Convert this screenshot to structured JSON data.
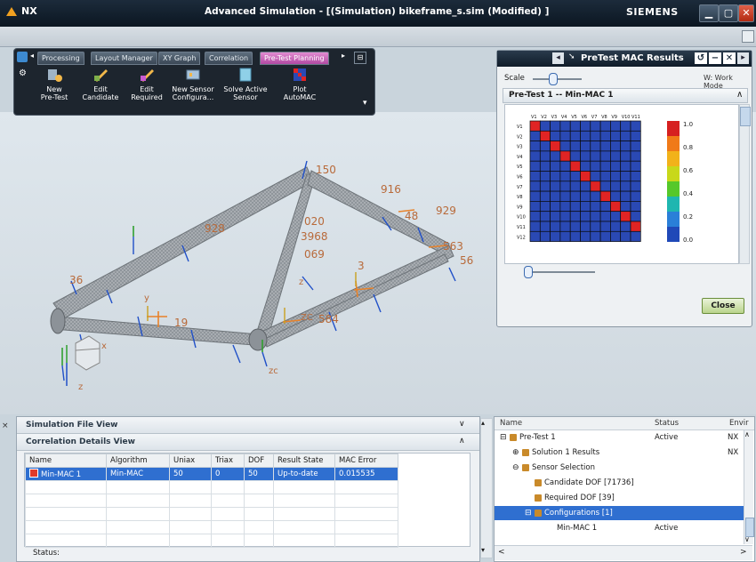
{
  "window": {
    "app": "NX",
    "title": "Advanced Simulation - [(Simulation) bikeframe_s.sim (Modified) ]",
    "brand": "SIEMENS"
  },
  "ribbon": {
    "tabs": [
      "Processing",
      "Layout Manager",
      "XY Graph",
      "Correlation",
      "Pre-Test Planning"
    ],
    "active_tab": "Pre-Test Planning",
    "tools": [
      {
        "line1": "New",
        "line2": "Pre-Test",
        "icon": "new-pretest-icon"
      },
      {
        "line1": "Edit",
        "line2": "Candidate",
        "icon": "edit-candidate-icon"
      },
      {
        "line1": "Edit",
        "line2": "Required",
        "icon": "edit-required-icon"
      },
      {
        "line1": "New Sensor",
        "line2": "Configura...",
        "icon": "new-sensor-configuration-icon"
      },
      {
        "line1": "Solve Active",
        "line2": "Sensor",
        "icon": "solve-active-sensor-icon"
      },
      {
        "line1": "Plot",
        "line2": "AutoMAC",
        "icon": "plot-automac-icon"
      }
    ]
  },
  "mac_dialog": {
    "title": "PreTest MAC Results",
    "scale_label": "Scale",
    "work_mode": "W: Work Mode",
    "selection": "Pre-Test 1 -- Min-MAC 1",
    "col_labels": [
      "V1",
      "V2",
      "V3",
      "V4",
      "V5",
      "V6",
      "V7",
      "V8",
      "V9",
      "V10",
      "V11"
    ],
    "row_labels": [
      "V1",
      "V2",
      "V3",
      "V4",
      "V5",
      "V6",
      "V7",
      "V8",
      "V9",
      "V10",
      "V11",
      "V12"
    ],
    "legend_ticks": [
      "1.0",
      "0.8",
      "0.6",
      "0.4",
      "0.2",
      "0.0"
    ],
    "legend_colors": [
      "#d62020",
      "#f07a18",
      "#f2b21a",
      "#c8d81a",
      "#56c82a",
      "#1fb6b0",
      "#2a7fd8",
      "#2049b8"
    ],
    "diag_color": "#e02424",
    "off_color": "#2a49b4",
    "close_label": "Close"
  },
  "model_labels": [
    "150",
    "916",
    "929",
    "020",
    "3968",
    "48",
    "928",
    "069",
    "563",
    "56",
    "3",
    "584",
    "36",
    "556",
    "z",
    "y",
    "x",
    "z",
    "zc",
    "ZC",
    "19"
  ],
  "sim_file_view": {
    "title": "Simulation File View"
  },
  "correlation_view": {
    "title": "Correlation Details View",
    "columns": [
      "Name",
      "Algorithm",
      "Uniax",
      "Triax",
      "DOF",
      "Result State",
      "MAC Error"
    ],
    "rows": [
      [
        "Min-MAC 1",
        "Min-MAC",
        "50",
        "0",
        "50",
        "Up-to-date",
        "0.015535"
      ]
    ],
    "status_label": "Status:"
  },
  "navigator": {
    "columns": [
      "Name",
      "Status",
      "Envir"
    ],
    "rows": [
      {
        "label": "Pre-Test 1",
        "status": "Active",
        "env": "NX",
        "indent": 0,
        "expander": "⊟",
        "icon": "pretest-folder-icon"
      },
      {
        "label": "Solution 1 Results",
        "status": "",
        "env": "NX",
        "indent": 1,
        "expander": "⊕",
        "icon": "solution-results-icon"
      },
      {
        "label": "Sensor Selection",
        "status": "",
        "env": "",
        "indent": 1,
        "expander": "⊖",
        "icon": "sensor-selection-icon"
      },
      {
        "label": "Candidate DOF [71736]",
        "status": "",
        "env": "",
        "indent": 2,
        "expander": "",
        "icon": "candidate-dof-icon"
      },
      {
        "label": "Required DOF [39]",
        "status": "",
        "env": "",
        "indent": 2,
        "expander": "",
        "icon": "required-dof-icon"
      },
      {
        "label": "Configurations [1]",
        "status": "",
        "env": "",
        "indent": 2,
        "expander": "⊟",
        "icon": "configurations-icon",
        "selected": true
      },
      {
        "label": "Min-MAC 1",
        "status": "Active",
        "env": "",
        "indent": 3,
        "expander": "",
        "icon": ""
      }
    ]
  }
}
